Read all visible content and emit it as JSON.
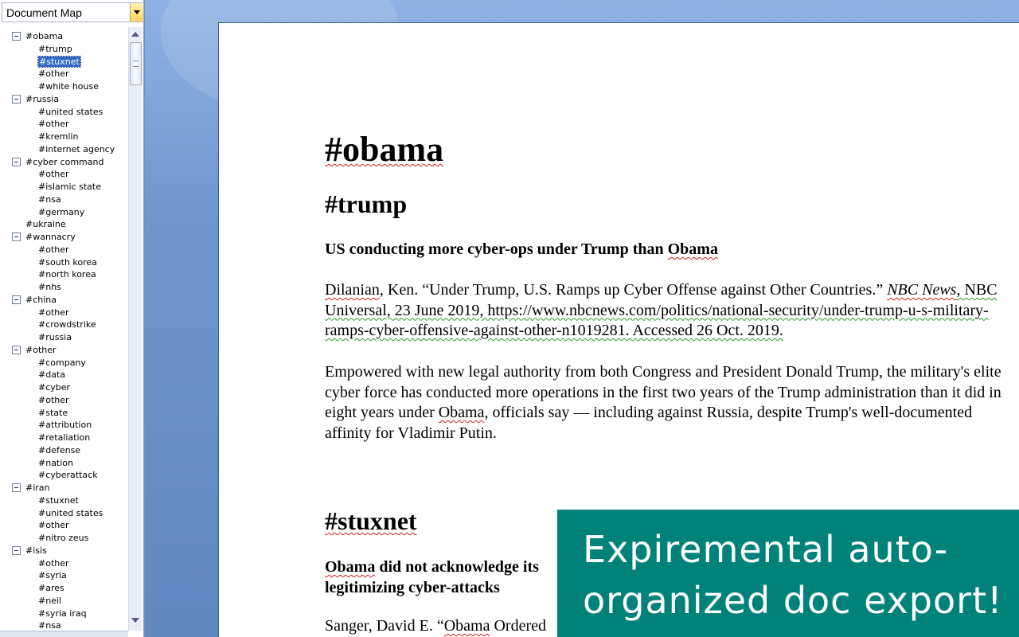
{
  "document_map": {
    "dropdown_label": "Document Map",
    "nodes": [
      {
        "label": "#obama",
        "level": 1,
        "expanded": true
      },
      {
        "label": "#trump",
        "level": 2
      },
      {
        "label": "#stuxnet",
        "level": 2,
        "selected": true
      },
      {
        "label": "#other",
        "level": 2
      },
      {
        "label": "#white house",
        "level": 2
      },
      {
        "label": "#russia",
        "level": 1,
        "expanded": true
      },
      {
        "label": "#united states",
        "level": 2
      },
      {
        "label": "#other",
        "level": 2
      },
      {
        "label": "#kremlin",
        "level": 2
      },
      {
        "label": "#internet agency",
        "level": 2
      },
      {
        "label": "#cyber command",
        "level": 1,
        "expanded": true
      },
      {
        "label": "#other",
        "level": 2
      },
      {
        "label": "#islamic state",
        "level": 2
      },
      {
        "label": "#nsa",
        "level": 2
      },
      {
        "label": "#germany",
        "level": 2
      },
      {
        "label": "#ukraine",
        "level": 1
      },
      {
        "label": "#wannacry",
        "level": 1,
        "expanded": true
      },
      {
        "label": "#other",
        "level": 2
      },
      {
        "label": "#south korea",
        "level": 2
      },
      {
        "label": "#north korea",
        "level": 2
      },
      {
        "label": "#nhs",
        "level": 2
      },
      {
        "label": "#china",
        "level": 1,
        "expanded": true
      },
      {
        "label": "#other",
        "level": 2
      },
      {
        "label": "#crowdstrike",
        "level": 2
      },
      {
        "label": "#russia",
        "level": 2
      },
      {
        "label": "#other",
        "level": 1,
        "expanded": true
      },
      {
        "label": "#company",
        "level": 2
      },
      {
        "label": "#data",
        "level": 2
      },
      {
        "label": "#cyber",
        "level": 2
      },
      {
        "label": "#other",
        "level": 2
      },
      {
        "label": "#state",
        "level": 2
      },
      {
        "label": "#attribution",
        "level": 2
      },
      {
        "label": "#retaliation",
        "level": 2
      },
      {
        "label": "#defense",
        "level": 2
      },
      {
        "label": "#nation",
        "level": 2
      },
      {
        "label": "#cyberattack",
        "level": 2
      },
      {
        "label": "#iran",
        "level": 1,
        "expanded": true
      },
      {
        "label": "#stuxnet",
        "level": 2
      },
      {
        "label": "#united states",
        "level": 2
      },
      {
        "label": "#other",
        "level": 2
      },
      {
        "label": "#nitro zeus",
        "level": 2
      },
      {
        "label": "#isis",
        "level": 1,
        "expanded": true
      },
      {
        "label": "#other",
        "level": 2
      },
      {
        "label": "#syria",
        "level": 2
      },
      {
        "label": "#ares",
        "level": 2
      },
      {
        "label": "#neil",
        "level": 2
      },
      {
        "label": "#syria iraq",
        "level": 2
      },
      {
        "label": "#nsa",
        "level": 2
      }
    ]
  },
  "document": {
    "h1": "#obama",
    "h2_trump": "#trump",
    "sub_trump_1": "US conducting more cyber-ops under Trump than ",
    "sub_trump_2": "Obama",
    "cite_trump_1": "Dilanian",
    "cite_trump_2": ", Ken. “Under Trump, U.S. Ramps up Cyber Offense against Other Countries.” ",
    "cite_trump_3": "NBC News",
    "cite_trump_4": ", NBC Universal, 23 June 2019, https://www.nbcnews.com/politics/national-security/under-trump-u-s-military-ramps-cyber-offensive-against-other-n1019281.  Accessed 26 Oct. 2019.",
    "body_trump_1": "Empowered with new legal authority from both Congress and President Donald Trump, the military's elite cyber force has conducted more operations in the first two years of the Trump administration than it did in eight years under ",
    "body_trump_2": "Obama",
    "body_trump_3": ", officials say — including against Russia, despite Trump's well-documented affinity for Vladimir Putin.",
    "h2_stuxnet": "#stuxnet",
    "sub_stuxnet_1": "Obama",
    "sub_stuxnet_2": " did not acknowledge its legitimizing cyber-attacks",
    "cite_stuxnet_1": "Sanger, David E. “",
    "cite_stuxnet_2": "Obama",
    "cite_stuxnet_3": " Ordered"
  },
  "banner": {
    "text": "Expiremental auto-organized doc export!"
  },
  "colors": {
    "banner_bg": "#00827a",
    "selection": "#316ac5",
    "workspace": "#6f96cd"
  }
}
